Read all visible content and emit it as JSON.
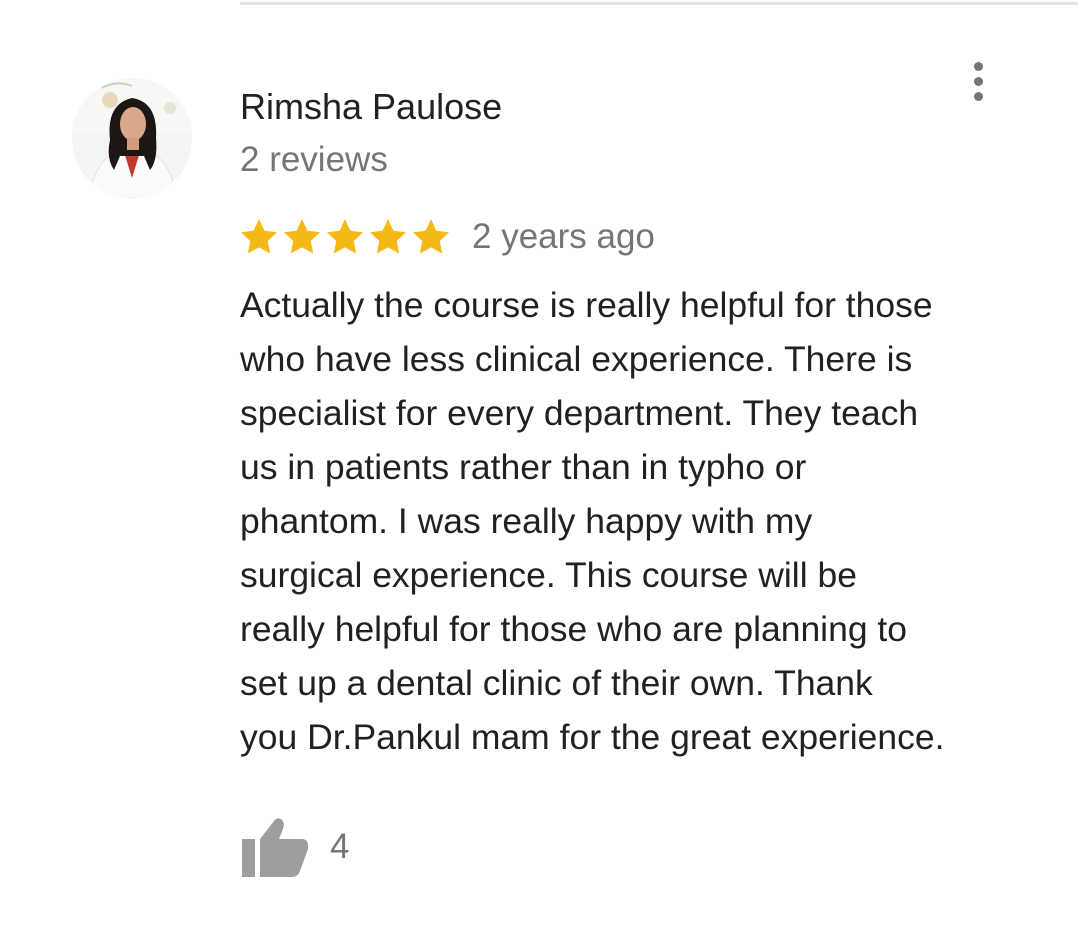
{
  "review": {
    "reviewer_name": "Rimsha Paulose",
    "reviewer_meta": "2 reviews",
    "rating": 5,
    "rating_max": 5,
    "date": "2 years ago",
    "text_lines": [
      "Actually the course is really helpful for those",
      "who have less clinical experience. There is",
      "specialist for every department. They teach",
      "us in patients rather than in typho or",
      "phantom. I was really happy with my",
      "surgical experience. This course will be",
      "really helpful for those who are planning to",
      "set up a dental clinic of their own. Thank",
      "you Dr.Pankul mam for the great experience."
    ],
    "helpful_count": "4"
  },
  "icons": {
    "avatar": "reviewer-avatar-photo",
    "more": "more-vert-icon",
    "star": "star-icon",
    "thumb": "thumb-up-icon"
  },
  "colors": {
    "star": "#F5B915",
    "text": "#202124",
    "secondary_text": "#757575",
    "icon_gray": "#9E9E9E",
    "divider": "#E3E3E3"
  }
}
